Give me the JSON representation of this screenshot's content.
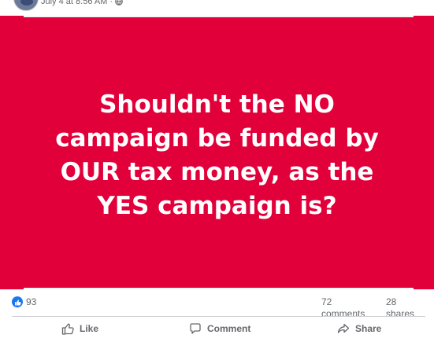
{
  "post": {
    "timestamp": "July 4 at 8:56 AM",
    "separator": "·",
    "image_text": {
      "line1": "Shouldn't the NO",
      "line2": "campaign be funded by",
      "line3": "OUR tax money,  as the",
      "line4": "YES campaign is?"
    },
    "colors": {
      "image_bg": "#e1003a",
      "text": "#ffffff",
      "like_blue": "#1877f2"
    }
  },
  "stats": {
    "reactions": "93",
    "comments_count": "72",
    "comments_label": "comments",
    "shares_count": "28",
    "shares_label": "shares"
  },
  "actions": {
    "like": "Like",
    "comment": "Comment",
    "share": "Share"
  },
  "icons": [
    "globe-icon",
    "like-reaction-icon",
    "thumbs-up-icon",
    "comment-icon",
    "share-icon"
  ]
}
